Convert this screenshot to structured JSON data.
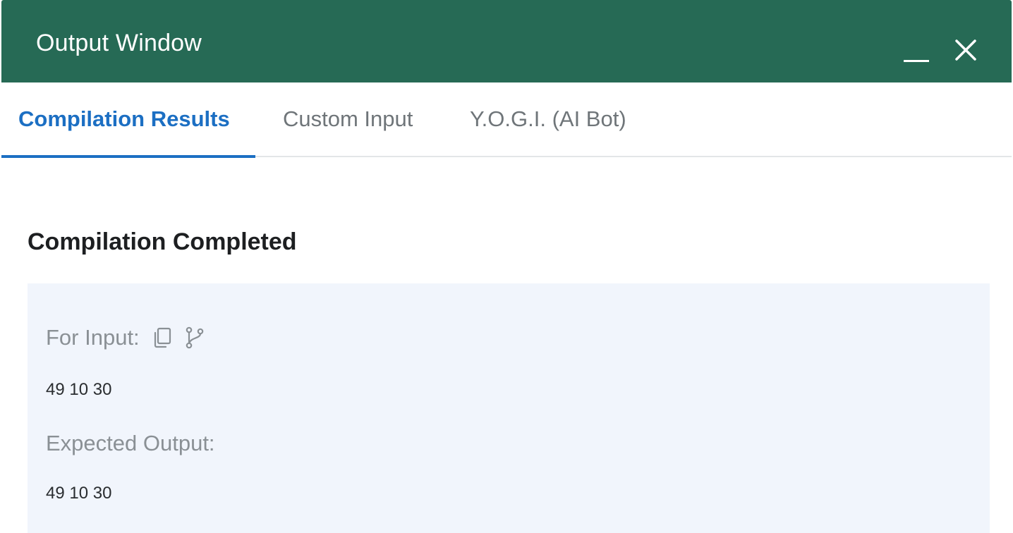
{
  "window": {
    "title": "Output Window",
    "controls": {
      "minimize_icon": "minimize-icon",
      "close_icon": "close-icon"
    },
    "colors": {
      "titlebar": "#266A55",
      "accent": "#1C6FC3",
      "panel_background": "#F1F5FC"
    }
  },
  "tabs": [
    {
      "label": "Compilation Results",
      "active": true
    },
    {
      "label": "Custom Input",
      "active": false
    },
    {
      "label": "Y.O.G.I. (AI Bot)",
      "active": false
    }
  ],
  "result": {
    "heading": "Compilation Completed",
    "input_label": "For Input:",
    "input_icons": [
      "copy-icon",
      "branch-icon"
    ],
    "input_value": "49 10 30",
    "expected_label": "Expected Output:",
    "expected_value": "49 10 30"
  }
}
